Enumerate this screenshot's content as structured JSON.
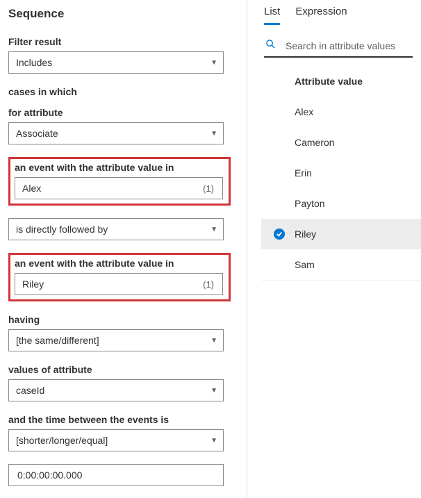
{
  "left": {
    "title": "Sequence",
    "filterResult": {
      "label": "Filter result",
      "value": "Includes"
    },
    "casesLabel": "cases in which",
    "forAttribute": {
      "label": "for attribute",
      "value": "Associate"
    },
    "event1": {
      "label": "an event with the attribute value in",
      "value": "Alex",
      "count": "(1)"
    },
    "followed": {
      "value": "is directly followed by"
    },
    "event2": {
      "label": "an event with the attribute value in",
      "value": "Riley",
      "count": "(1)"
    },
    "having": {
      "label": "having",
      "value": "[the same/different]"
    },
    "valuesOf": {
      "label": "values of attribute",
      "value": "caseId"
    },
    "timeBetween": {
      "label": "and the time between the events is",
      "value": "[shorter/longer/equal]"
    },
    "duration": {
      "value": "0:00:00:00.000"
    }
  },
  "right": {
    "tabs": {
      "list": "List",
      "expression": "Expression"
    },
    "searchPlaceholder": "Search in attribute values",
    "listHeader": "Attribute value",
    "items": [
      {
        "label": "Alex",
        "selected": false
      },
      {
        "label": "Cameron",
        "selected": false
      },
      {
        "label": "Erin",
        "selected": false
      },
      {
        "label": "Payton",
        "selected": false
      },
      {
        "label": "Riley",
        "selected": true
      },
      {
        "label": "Sam",
        "selected": false
      }
    ]
  }
}
